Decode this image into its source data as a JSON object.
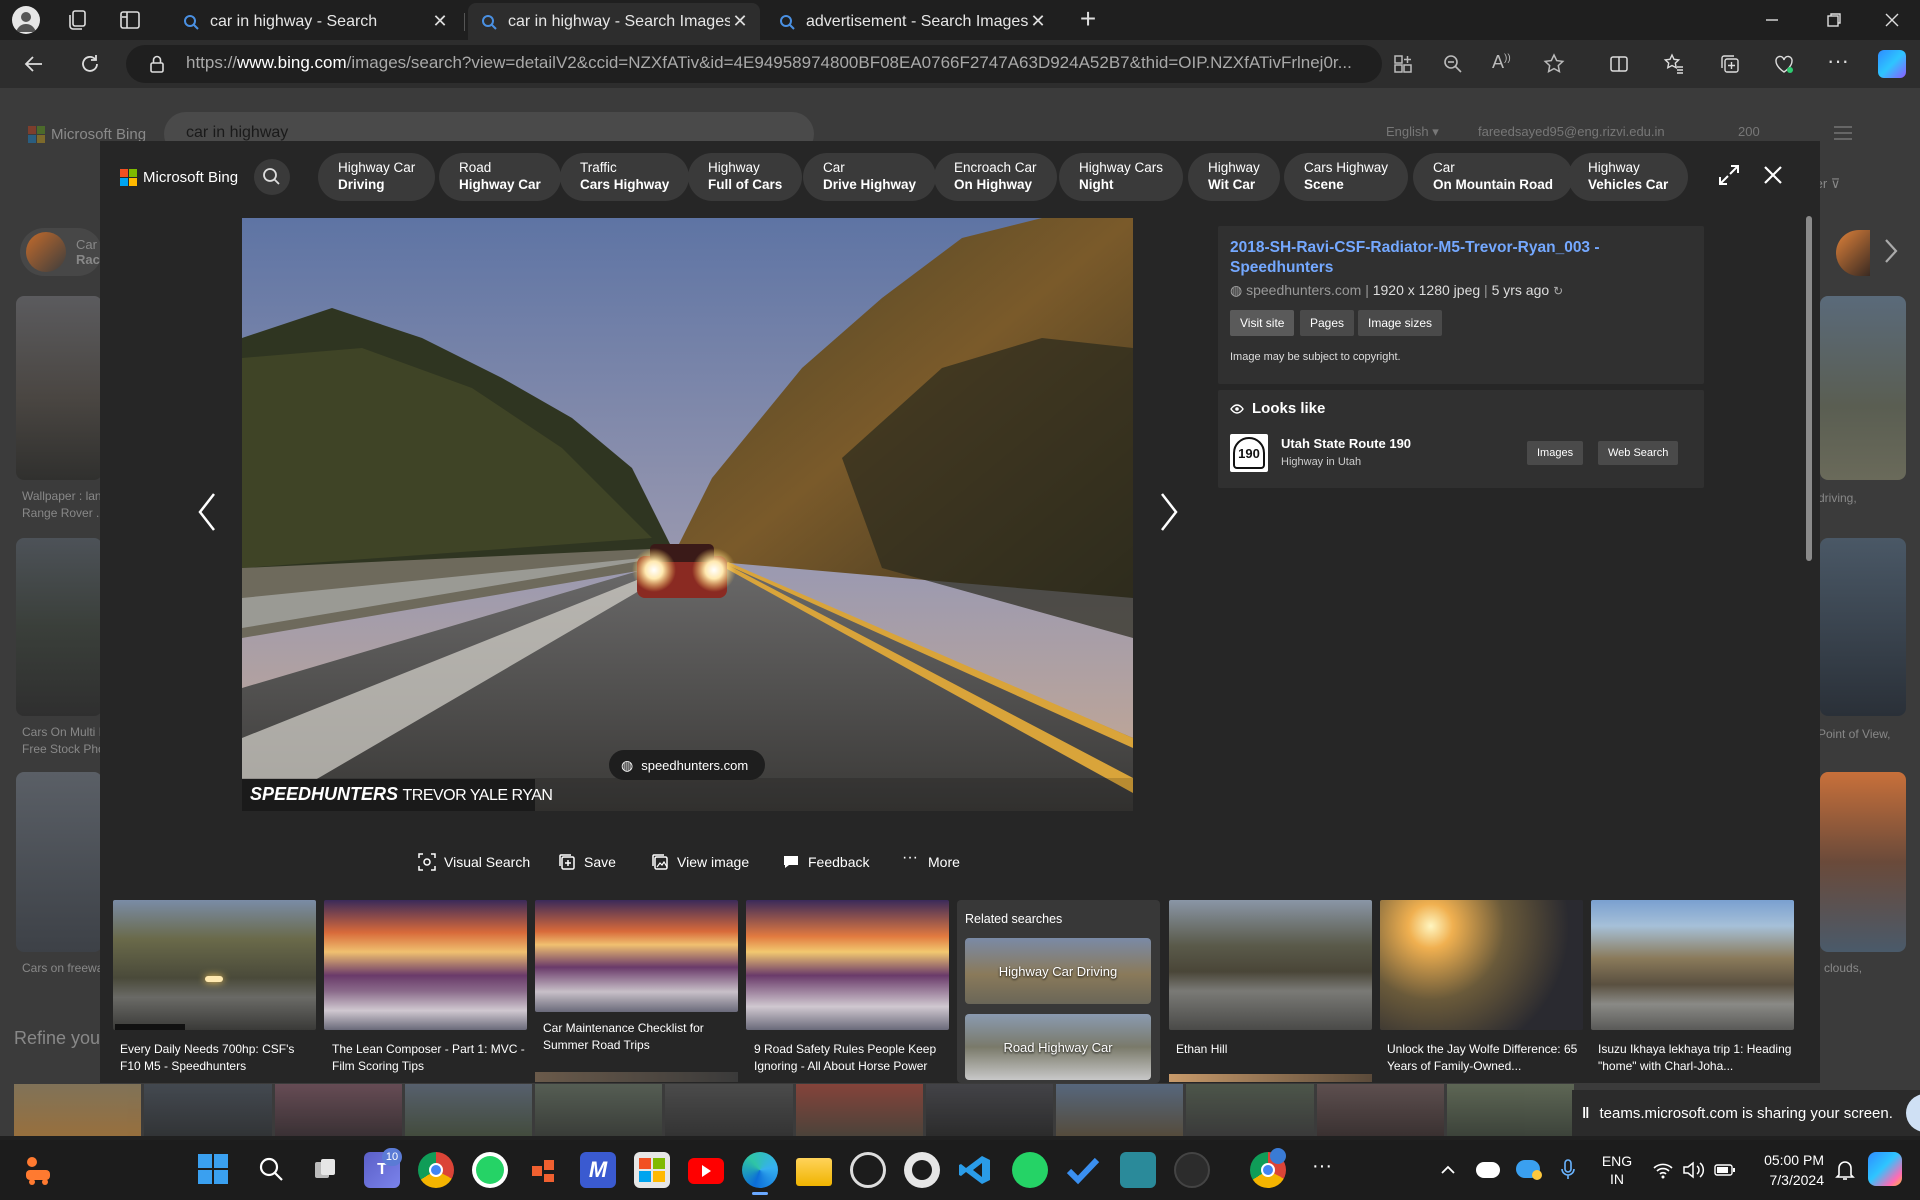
{
  "browser": {
    "tabs": [
      {
        "title": "car in highway - Search",
        "active": false
      },
      {
        "title": "car in highway - Search Images",
        "active": true
      },
      {
        "title": "advertisement - Search Images",
        "active": false
      }
    ],
    "url_prefix": "https://",
    "url_domain": "www.bing.com",
    "url_rest": "/images/search?view=detailV2&ccid=NZXfATiv&id=4E94958974800BF08EA0766F2747A63D924A52B7&thid=OIP.NZXfATivFrlnej0r..."
  },
  "bing_page": {
    "logo": "Microsoft Bing",
    "search_value": "car in highway",
    "language": "English",
    "email": "fareedsayed95@eng.rizvi.edu.in",
    "points": "200",
    "left_results": [
      {
        "line1": "Car",
        "line2": "Rac"
      },
      {
        "line1": "Wallpaper : lan",
        "line2": "Range Rover ..."
      },
      {
        "line1": "Cars On Multi I",
        "line2": "Free Stock Pho"
      },
      {
        "line1": "Cars on freewa",
        "line2": ""
      }
    ],
    "right_results": [
      "driving,",
      "Point of View,",
      "clouds,"
    ],
    "refine_label": "Refine your",
    "filter_label": "ter"
  },
  "viewer": {
    "logo": "Microsoft Bing",
    "chips": [
      {
        "l1": "Highway Car",
        "l2": "Driving"
      },
      {
        "l1": "Road",
        "l2": "Highway Car"
      },
      {
        "l1": "Traffic",
        "l2": "Cars Highway"
      },
      {
        "l1": "Highway",
        "l2": "Full of Cars"
      },
      {
        "l1": "Car",
        "l2": "Drive Highway"
      },
      {
        "l1": "Encroach Car",
        "l2": "On Highway"
      },
      {
        "l1": "Highway Cars",
        "l2": "Night"
      },
      {
        "l1": "Highway",
        "l2": "Wit Car"
      },
      {
        "l1": "Cars Highway",
        "l2": "Scene"
      },
      {
        "l1": "Car",
        "l2": "On Mountain Road"
      },
      {
        "l1": "Highway",
        "l2": "Vehicles Car"
      }
    ],
    "image_source_pill": "speedhunters.com",
    "watermark_brand": "SPEEDHUNTERS",
    "watermark_credit": "TREVOR YALE RYAN",
    "title": "2018-SH-Ravi-CSF-Radiator-M5-Trevor-Ryan_003 - Speedhunters",
    "site": "speedhunters.com",
    "dimensions": "1920 x 1280 jpeg",
    "age": "5 yrs ago",
    "buttons": [
      "Visit site",
      "Pages",
      "Image sizes"
    ],
    "copyright": "Image may be subject to copyright.",
    "looks_like_header": "Looks like",
    "looks_like": {
      "name": "Utah State Route 190",
      "desc": "Highway in Utah",
      "badge": "190",
      "btn_images": "Images",
      "btn_web": "Web Search"
    },
    "actions": [
      "Visual Search",
      "Save",
      "View image",
      "Feedback",
      "More"
    ],
    "related_header": "Related searches",
    "related": [
      "Highway Car Driving",
      "Road Highway Car"
    ],
    "thumbs": [
      {
        "caption": "Every Daily Needs 700hp: CSF's F10 M5 - Speedhunters"
      },
      {
        "caption": "The Lean Composer - Part 1: MVC - Film Scoring Tips"
      },
      {
        "caption": "Car Maintenance Checklist for Summer Road Trips"
      },
      {
        "caption": "9 Road Safety Rules People Keep Ignoring - All About Horse Power"
      },
      {
        "caption": "Ethan Hill"
      },
      {
        "caption": "Unlock the Jay Wolfe Difference: 65 Years of Family-Owned..."
      },
      {
        "caption": "Isuzu Ikhaya lekhaya trip 1: Heading \"home\" with Charl-Joha..."
      }
    ]
  },
  "sharing_banner": "teams.microsoft.com is sharing your screen.",
  "taskbar": {
    "teams_badge": "10",
    "lang_line1": "ENG",
    "lang_line2": "IN",
    "time": "05:00 PM",
    "date": "7/3/2024"
  },
  "colors": {
    "bing_link": "#74a8ff",
    "accent": "#0078d4"
  }
}
